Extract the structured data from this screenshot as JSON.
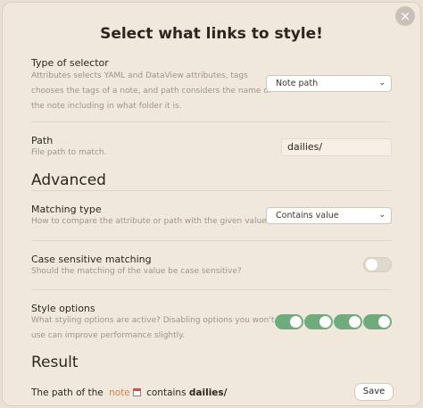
{
  "modal": {
    "title": "Select what links to style!",
    "close_glyph": "×"
  },
  "selector_type": {
    "name": "Type of selector",
    "desc_lines": [
      "Attributes selects YAML and DataView attributes, tags",
      "chooses the tags of a note, and path considers the name of",
      "the note including in what folder it is."
    ],
    "value": "Note path"
  },
  "path": {
    "name": "Path",
    "desc": "File path to match.",
    "value": "dailies/"
  },
  "advanced": {
    "heading": "Advanced"
  },
  "matching_type": {
    "name": "Matching type",
    "desc": "How to compare the attribute or path with the given value.",
    "value": "Contains value"
  },
  "case_sensitive": {
    "name": "Case sensitive matching",
    "desc": "Should the matching of the value be case sensitive?",
    "enabled": false
  },
  "style_options": {
    "name": "Style options",
    "desc_lines": [
      "What styling options are active? Disabling options you won't",
      "use can improve performance slightly."
    ],
    "toggles": [
      true,
      true,
      true,
      true
    ]
  },
  "result": {
    "heading": "Result",
    "prefix": "The path of the",
    "link": "note",
    "middle": "contains",
    "value": "dailies/",
    "save_label": "Save"
  },
  "colors": {
    "toggle_on": "#6fab7c",
    "link": "#d9804a",
    "background": "#f0e8dd"
  }
}
